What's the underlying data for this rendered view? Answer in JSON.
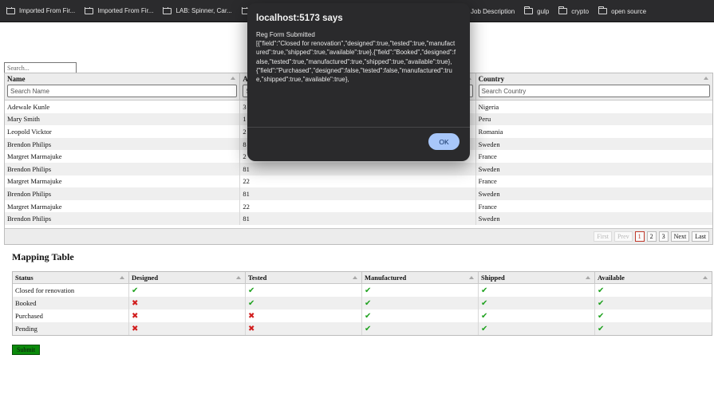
{
  "bookmarks": {
    "left": [
      "Imported From Fir...",
      "Imported From Fir...",
      "LAB: Spinner, Car...",
      ""
    ],
    "right": [
      "Job Description",
      "gulp",
      "crypto",
      "open source"
    ]
  },
  "global_search": {
    "placeholder": "Search..."
  },
  "grid": {
    "columns": [
      {
        "title": "Name",
        "placeholder": "Search Name"
      },
      {
        "title": "A",
        "placeholder": "S"
      },
      {
        "title": "Country",
        "placeholder": "Search Country"
      }
    ],
    "rows": [
      [
        "Adewale Kunle",
        "3",
        "Nigeria"
      ],
      [
        "Mary Smith",
        "1",
        "Peru"
      ],
      [
        "Leopold Vicktor",
        "2",
        "Romania"
      ],
      [
        "Brendon Philips",
        "8",
        "Sweden"
      ],
      [
        "Margret Marmajuke",
        "2",
        "France"
      ],
      [
        "Brendon Philips",
        "81",
        "Sweden"
      ],
      [
        "Margret Marmajuke",
        "22",
        "France"
      ],
      [
        "Brendon Philips",
        "81",
        "Sweden"
      ],
      [
        "Margret Marmajuke",
        "22",
        "France"
      ],
      [
        "Brendon Philips",
        "81",
        "Sweden"
      ]
    ],
    "pager": {
      "first": "First",
      "prev": "Prev",
      "pages": [
        "1",
        "2",
        "3"
      ],
      "next": "Next",
      "last": "Last",
      "current": "1"
    }
  },
  "mapping": {
    "title": "Mapping Table",
    "columns": [
      "Status",
      "Designed",
      "Tested",
      "Manufactured",
      "Shipped",
      "Available"
    ],
    "rows": [
      {
        "status": "Closed for renovation",
        "values": [
          true,
          true,
          true,
          true,
          true
        ]
      },
      {
        "status": "Booked",
        "values": [
          false,
          true,
          true,
          true,
          true
        ]
      },
      {
        "status": "Purchased",
        "values": [
          false,
          false,
          true,
          true,
          true
        ]
      },
      {
        "status": "Pending",
        "values": [
          false,
          false,
          true,
          true,
          true
        ]
      }
    ],
    "check_color": "#1fa21f",
    "cross_color": "#d11d1d"
  },
  "submit_label": "Submit",
  "dialog": {
    "title": "localhost:5173 says",
    "message": "Reg Form Submitted\n[{\"field\":\"Closed for renovation\",\"designed\":true,\"tested\":true,\"manufactured\":true,\"shipped\":true,\"available\":true},{\"field\":\"Booked\",\"designed\":false,\"tested\":true,\"manufactured\":true,\"shipped\":true,\"available\":true},{\"field\":\"Purchased\",\"designed\":false,\"tested\":false,\"manufactured\":true,\"shipped\":true,\"available\":true},",
    "ok_label": "OK"
  }
}
